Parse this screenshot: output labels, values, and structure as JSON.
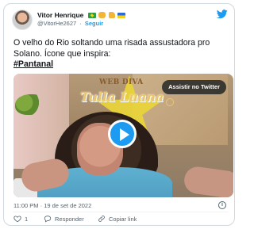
{
  "author": {
    "name": "Vitor Henrique",
    "handle": "@VitorHe2627",
    "follow_label": "Seguir",
    "separator": "·"
  },
  "tweet": {
    "text": "O velho do Rio soltando uma risada assustadora pro Solano. Ícone que inspira:",
    "hashtag": "#Pantanal"
  },
  "media": {
    "watch_label": "Assistir no Twitter",
    "logo_web": "WEB DIVA",
    "logo_name": "Tulla Luana"
  },
  "timestamp": "11:00 PM · 19 de set de 2022",
  "actions": {
    "like_count": "1",
    "reply_label": "Responder",
    "copy_label": "Copiar link"
  },
  "colors": {
    "accent": "#1d9bf0",
    "text": "#0f1419",
    "muted": "#536471",
    "border": "#cfd9de"
  }
}
